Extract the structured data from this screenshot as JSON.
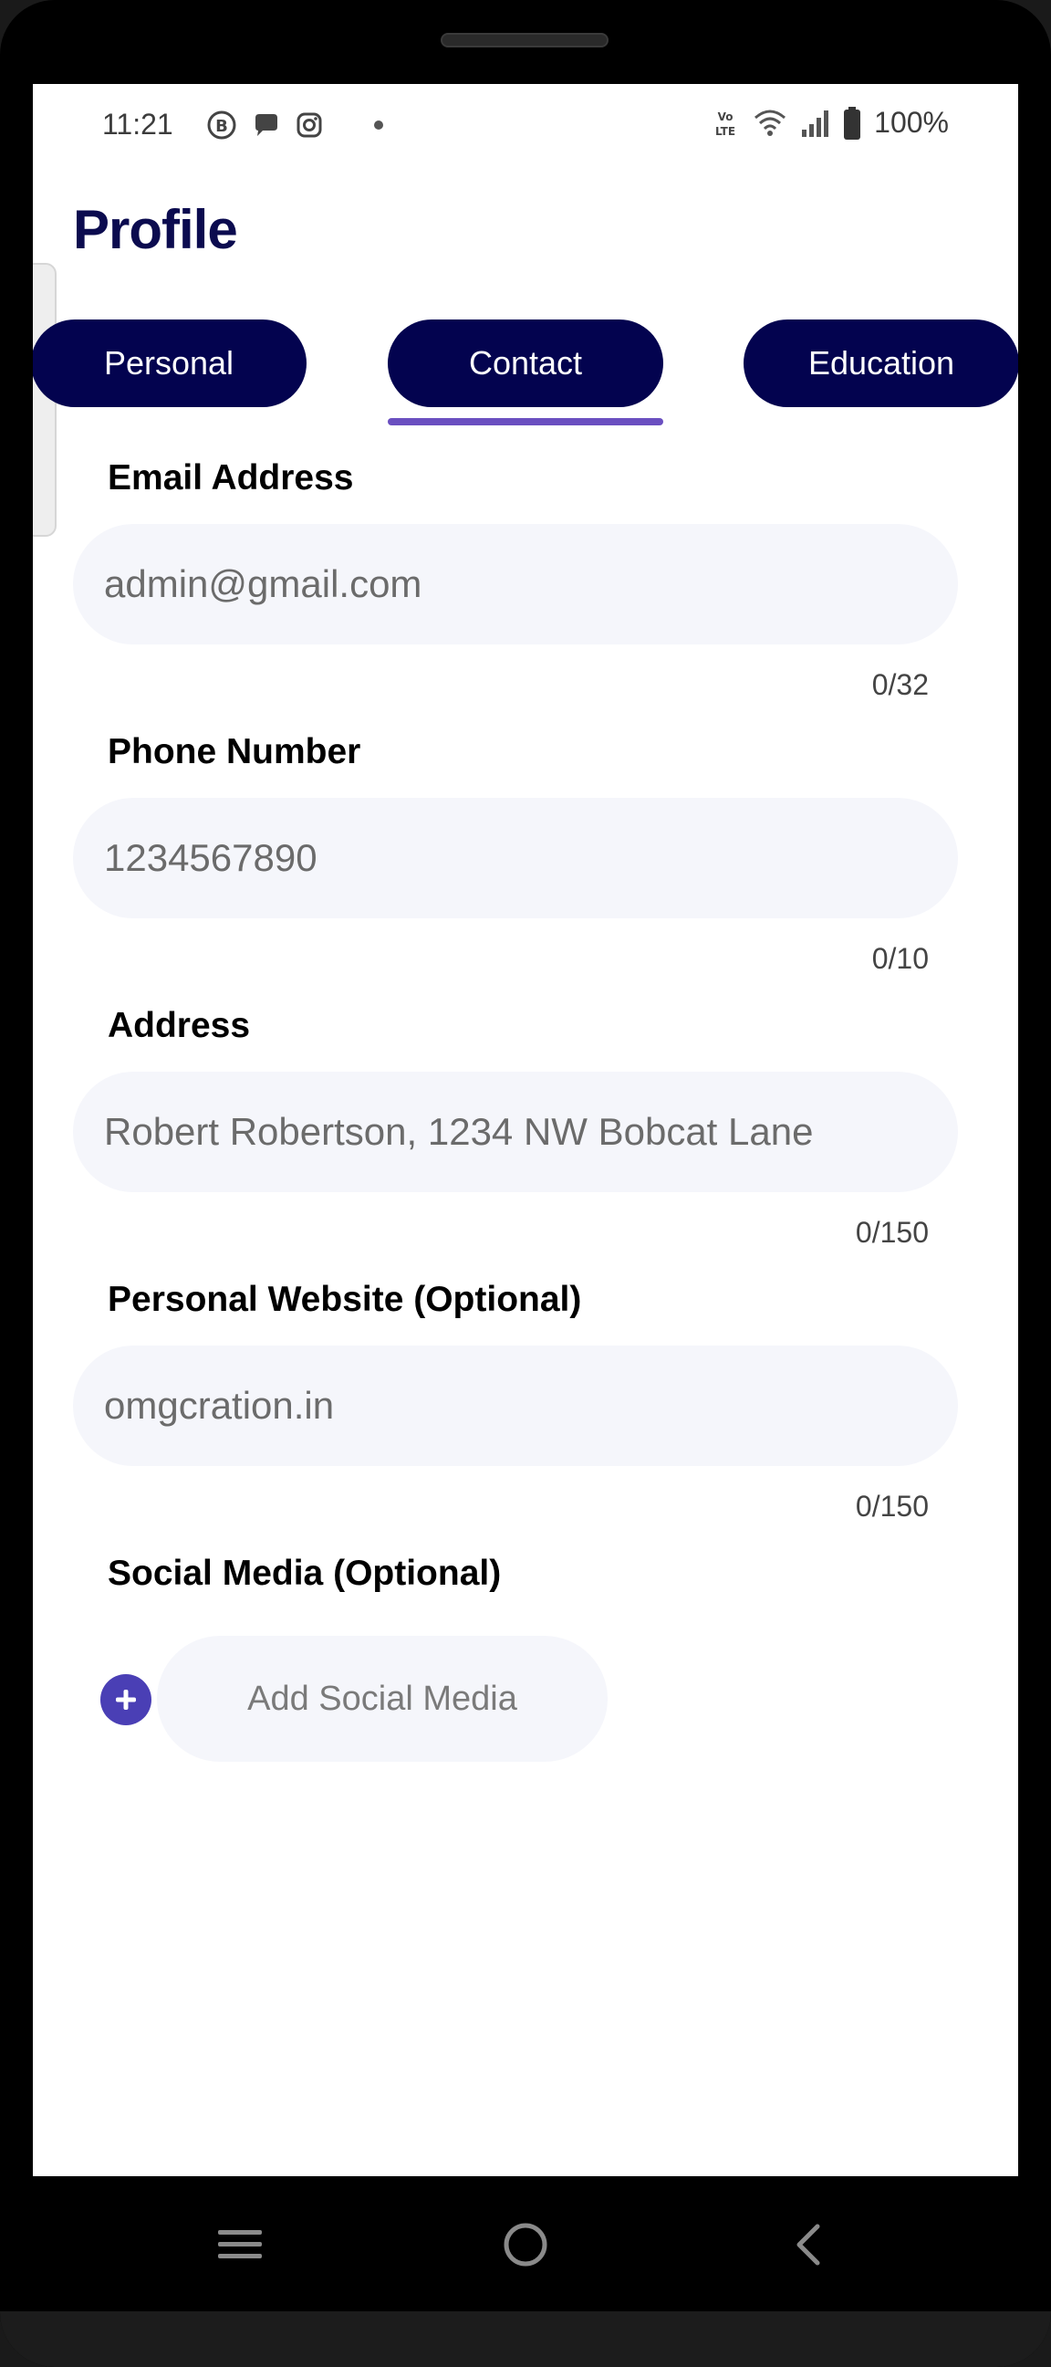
{
  "status_bar": {
    "time": "11:21",
    "battery": "100%",
    "left_icons": [
      "b-icon",
      "chat-icon",
      "instagram-icon",
      "dot-icon"
    ],
    "right_icons": [
      "volte-icon",
      "wifi-icon",
      "signal-icon",
      "battery-icon"
    ]
  },
  "header": {
    "title": "Profile"
  },
  "tabs": [
    {
      "label": "Personal",
      "active": false
    },
    {
      "label": "Contact",
      "active": true
    },
    {
      "label": "Education",
      "active": false
    }
  ],
  "fields": {
    "email": {
      "label": "Email Address",
      "placeholder": "admin@gmail.com",
      "counter": "0/32"
    },
    "phone": {
      "label": "Phone Number",
      "placeholder": "1234567890",
      "counter": "0/10"
    },
    "address": {
      "label": "Address",
      "placeholder": "Robert Robertson, 1234 NW Bobcat Lane",
      "counter": "0/150"
    },
    "website": {
      "label": "Personal Website (Optional)",
      "placeholder": "omgcration.in",
      "counter": "0/150"
    }
  },
  "social": {
    "label": "Social Media (Optional)",
    "add_button": "Add Social Media"
  },
  "colors": {
    "tab_bg": "#03034f",
    "title": "#0b0b4f",
    "indicator": "#6a4fc0",
    "plus_button": "#4a3fb5",
    "input_bg": "#f5f6fb"
  },
  "nav_bar": {
    "buttons": [
      "menu-icon",
      "home-icon",
      "back-icon"
    ]
  }
}
